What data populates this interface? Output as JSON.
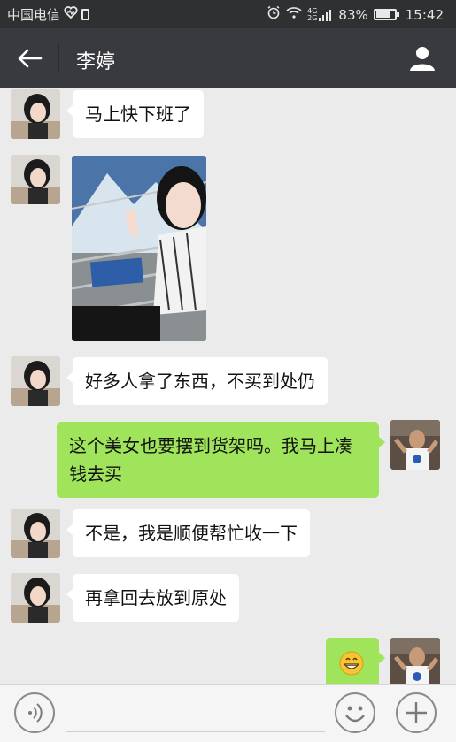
{
  "status_bar": {
    "carrier": "中国电信",
    "battery_percent": "83%",
    "battery_level": 0.83,
    "time": "15:42",
    "network": "4G"
  },
  "header": {
    "title": "李婷",
    "back_icon": "back-arrow-icon",
    "profile_icon": "person-icon"
  },
  "messages": [
    {
      "side": "in",
      "type": "text",
      "text": "马上快下班了"
    },
    {
      "side": "in",
      "type": "image"
    },
    {
      "side": "in",
      "type": "text",
      "text": "好多人拿了东西，不买到处仍"
    },
    {
      "side": "out",
      "type": "text",
      "text": "这个美女也要摆到货架吗。我马上凑钱去买"
    },
    {
      "side": "in",
      "type": "text",
      "text": "不是，我是顺便帮忙收一下"
    },
    {
      "side": "in",
      "type": "text",
      "text": "再拿回去放到原处"
    },
    {
      "side": "out",
      "type": "emoji",
      "emoji": "grinning-face"
    }
  ],
  "input_bar": {
    "voice_icon": "voice-icon",
    "emoji_icon": "emoji-icon",
    "plus_icon": "plus-icon",
    "placeholder": ""
  },
  "colors": {
    "status_bg": "#2e3032",
    "header_bg": "#393a3f",
    "chat_bg": "#ebebeb",
    "bubble_in": "#ffffff",
    "bubble_out": "#9fe45b"
  }
}
